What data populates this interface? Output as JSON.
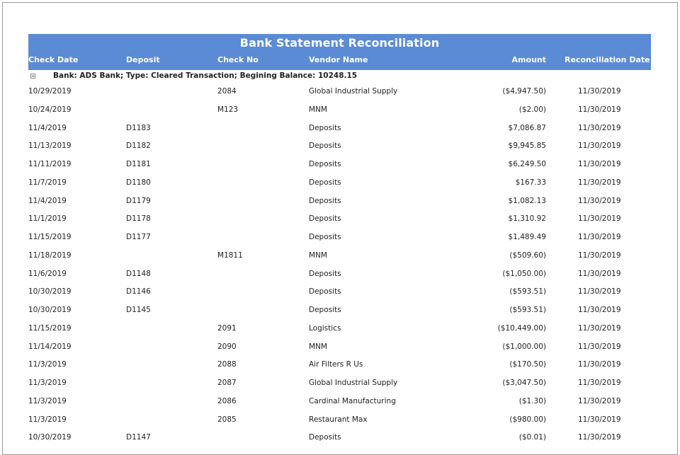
{
  "report": {
    "title": "Bank Statement Reconciliation",
    "columns": {
      "check_date": "Check Date",
      "deposit": "Deposit",
      "check_no": "Check No",
      "vendor_name": "Vendor Name",
      "amount": "Amount",
      "reconciliation_date": "Reconciliation Date"
    },
    "group_label": "Bank: ADS Bank; Type: Cleared Transaction; Begining Balance: 10248.15",
    "header_color": "#5b8bd5",
    "rows": [
      {
        "check_date": "10/29/2019",
        "deposit": "",
        "check_no": "2084",
        "vendor": "Global Industrial Supply",
        "amount": "($4,947.50)",
        "recon_date": "11/30/2019"
      },
      {
        "check_date": "10/24/2019",
        "deposit": "",
        "check_no": "M123",
        "vendor": "MNM",
        "amount": "($2.00)",
        "recon_date": "11/30/2019"
      },
      {
        "check_date": "11/4/2019",
        "deposit": "D1183",
        "check_no": "",
        "vendor": "Deposits",
        "amount": "$7,086.87",
        "recon_date": "11/30/2019"
      },
      {
        "check_date": "11/13/2019",
        "deposit": "D1182",
        "check_no": "",
        "vendor": "Deposits",
        "amount": "$9,945.85",
        "recon_date": "11/30/2019"
      },
      {
        "check_date": "11/11/2019",
        "deposit": "D1181",
        "check_no": "",
        "vendor": "Deposits",
        "amount": "$6,249.50",
        "recon_date": "11/30/2019"
      },
      {
        "check_date": "11/7/2019",
        "deposit": "D1180",
        "check_no": "",
        "vendor": "Deposits",
        "amount": "$167.33",
        "recon_date": "11/30/2019"
      },
      {
        "check_date": "11/4/2019",
        "deposit": "D1179",
        "check_no": "",
        "vendor": "Deposits",
        "amount": "$1,082.13",
        "recon_date": "11/30/2019"
      },
      {
        "check_date": "11/1/2019",
        "deposit": "D1178",
        "check_no": "",
        "vendor": "Deposits",
        "amount": "$1,310.92",
        "recon_date": "11/30/2019"
      },
      {
        "check_date": "11/15/2019",
        "deposit": "D1177",
        "check_no": "",
        "vendor": "Deposits",
        "amount": "$1,489.49",
        "recon_date": "11/30/2019"
      },
      {
        "check_date": "11/18/2019",
        "deposit": "",
        "check_no": "M1811",
        "vendor": "MNM",
        "amount": "($509.60)",
        "recon_date": "11/30/2019"
      },
      {
        "check_date": "11/6/2019",
        "deposit": "D1148",
        "check_no": "",
        "vendor": "Deposits",
        "amount": "($1,050.00)",
        "recon_date": "11/30/2019"
      },
      {
        "check_date": "10/30/2019",
        "deposit": "D1146",
        "check_no": "",
        "vendor": "Deposits",
        "amount": "($593.51)",
        "recon_date": "11/30/2019"
      },
      {
        "check_date": "10/30/2019",
        "deposit": "D1145",
        "check_no": "",
        "vendor": "Deposits",
        "amount": "($593.51)",
        "recon_date": "11/30/2019"
      },
      {
        "check_date": "11/15/2019",
        "deposit": "",
        "check_no": "2091",
        "vendor": "Logistics",
        "amount": "($10,449.00)",
        "recon_date": "11/30/2019"
      },
      {
        "check_date": "11/14/2019",
        "deposit": "",
        "check_no": "2090",
        "vendor": "MNM",
        "amount": "($1,000.00)",
        "recon_date": "11/30/2019"
      },
      {
        "check_date": "11/3/2019",
        "deposit": "",
        "check_no": "2088",
        "vendor": "Air Filters R Us",
        "amount": "($170.50)",
        "recon_date": "11/30/2019"
      },
      {
        "check_date": "11/3/2019",
        "deposit": "",
        "check_no": "2087",
        "vendor": "Global Industrial Supply",
        "amount": "($3,047.50)",
        "recon_date": "11/30/2019"
      },
      {
        "check_date": "11/3/2019",
        "deposit": "",
        "check_no": "2086",
        "vendor": "Cardinal Manufacturing",
        "amount": "($1.30)",
        "recon_date": "11/30/2019"
      },
      {
        "check_date": "11/3/2019",
        "deposit": "",
        "check_no": "2085",
        "vendor": "Restaurant Max",
        "amount": "($980.00)",
        "recon_date": "11/30/2019"
      },
      {
        "check_date": "10/30/2019",
        "deposit": "D1147",
        "check_no": "",
        "vendor": "Deposits",
        "amount": "($0.01)",
        "recon_date": "11/30/2019"
      }
    ]
  }
}
